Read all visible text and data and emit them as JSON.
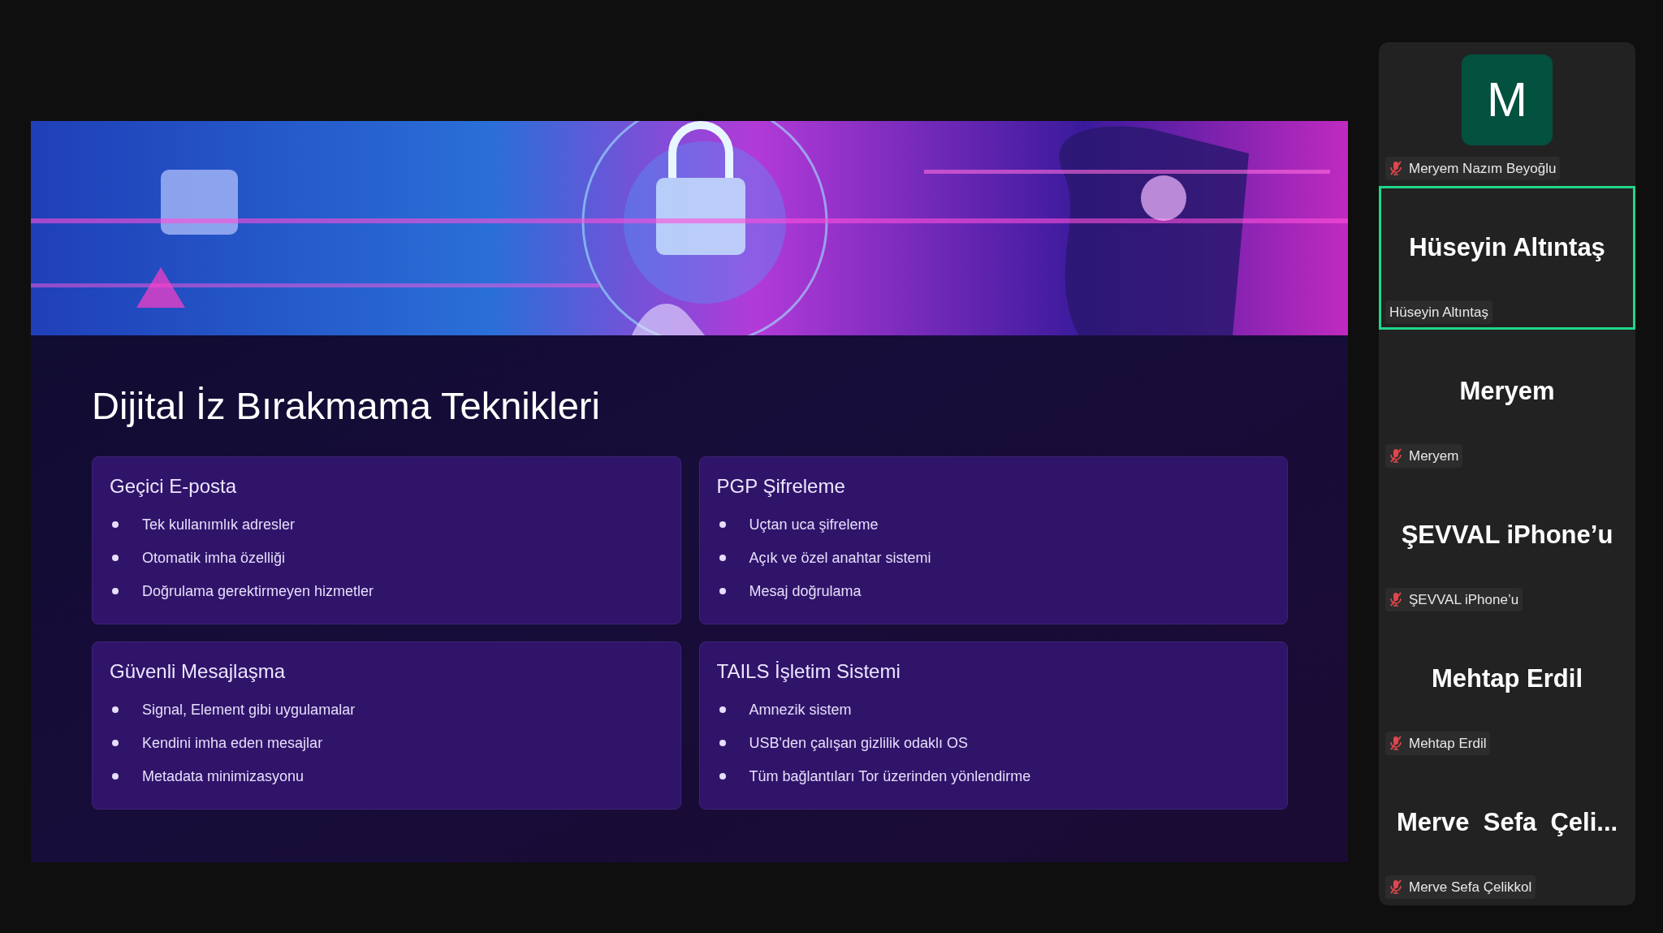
{
  "slide": {
    "title": "Dijital İz Bırakmama Teknikleri",
    "cards": [
      {
        "heading": "Geçici E-posta",
        "bullets": [
          "Tek kullanımlık adresler",
          "Otomatik imha özelliği",
          "Doğrulama gerektirmeyen hizmetler"
        ]
      },
      {
        "heading": "PGP Şifreleme",
        "bullets": [
          "Uçtan uca şifreleme",
          "Açık ve özel anahtar sistemi",
          "Mesaj doğrulama"
        ]
      },
      {
        "heading": "Güvenli Mesajlaşma",
        "bullets": [
          "Signal, Element gibi uygulamalar",
          "Kendini imha eden mesajlar",
          "Metadata minimizasyonu"
        ]
      },
      {
        "heading": "TAILS İşletim Sistemi",
        "bullets": [
          "Amnezik sistem",
          "USB'den çalışan gizlilik odaklı OS",
          "Tüm bağlantıları Tor üzerinden yönlendirme"
        ]
      }
    ]
  },
  "participants": [
    {
      "kind": "avatar",
      "avatar": "M",
      "label": "Meryem Nazım Beyoğlu",
      "muted": true,
      "speaking": false
    },
    {
      "kind": "name",
      "display_name": "Hüseyin Altıntaş",
      "label": "Hüseyin Altıntaş",
      "muted": false,
      "speaking": true
    },
    {
      "kind": "name",
      "display_name": "Meryem",
      "label": "Meryem",
      "muted": true,
      "speaking": false
    },
    {
      "kind": "name",
      "display_name": "ŞEVVAL iPhone’u",
      "label": "ŞEVVAL iPhone’u",
      "muted": true,
      "speaking": false
    },
    {
      "kind": "name",
      "display_name": "Mehtap Erdil",
      "label": "Mehtap Erdil",
      "muted": true,
      "speaking": false
    },
    {
      "kind": "name",
      "display_name": "Merve  Sefa  Çeli...",
      "label": "Merve Sefa Çelikkol",
      "muted": true,
      "speaking": false
    }
  ]
}
